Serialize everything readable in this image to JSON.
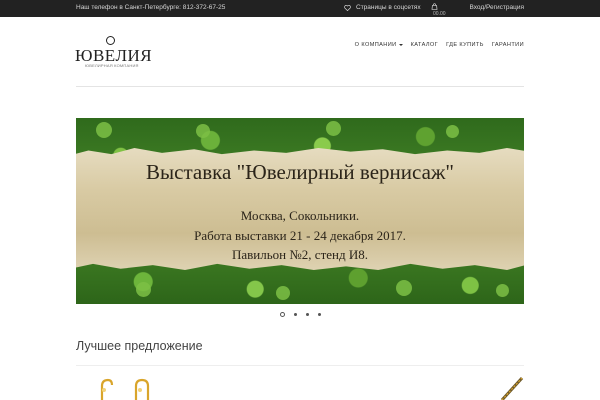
{
  "topbar": {
    "phone": "Наш телефон в Санкт-Петербурге: 812-372-67-25",
    "social": "Страницы в соцсетях",
    "cart_total": "00.00",
    "login": "Вход/Регистрация"
  },
  "logo": {
    "name": "ЮВЕЛИЯ",
    "subtitle": "ЮВЕЛИРНАЯ КОМПАНИЯ"
  },
  "nav": {
    "items": [
      {
        "label": "О КОМПАНИИ"
      },
      {
        "label": "КАТАЛОГ"
      },
      {
        "label": "ГДЕ КУПИТЬ"
      },
      {
        "label": "ГАРАНТИИ"
      }
    ]
  },
  "slider": {
    "title": "Выставка \"Ювелирный вернисаж\"",
    "line1": "Москва, Сокольники.",
    "line2": "Работа выставки 21 - 24 декабря 2017.",
    "line3": "Павильон №2, стенд И8.",
    "slide_count": 4,
    "active_slide": 1
  },
  "section": {
    "title": "Лучшее предложение"
  },
  "colors": {
    "topbar_bg": "#222222",
    "accent_gold": "#d9a52b"
  }
}
